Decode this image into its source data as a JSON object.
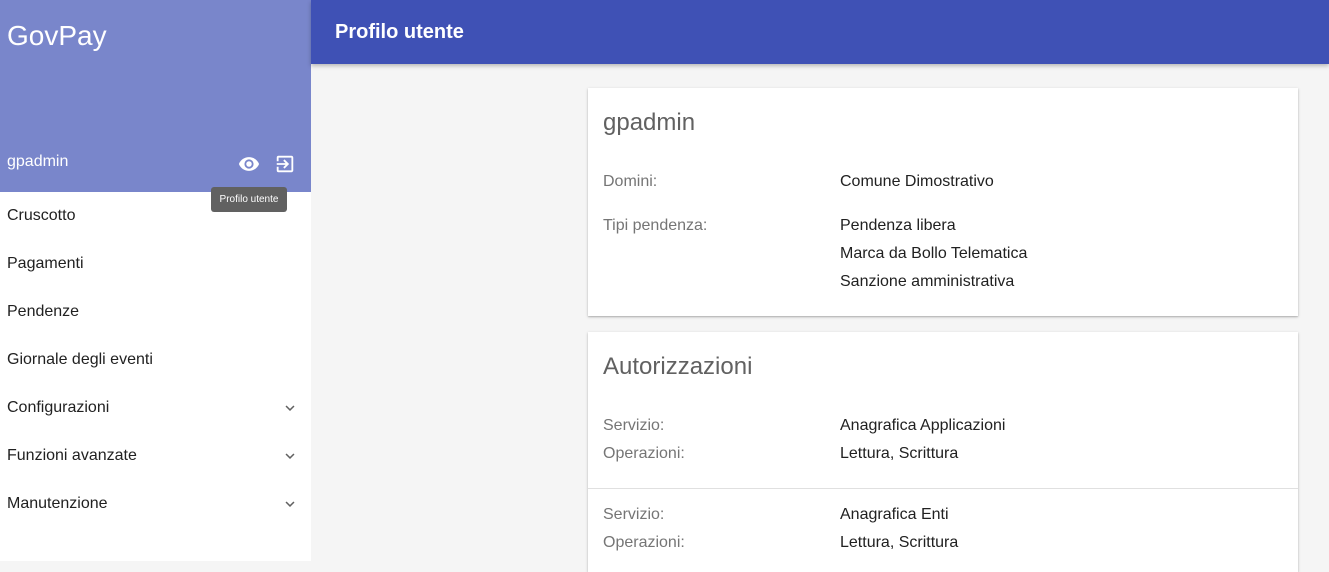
{
  "app": {
    "title": "GovPay"
  },
  "user": {
    "name": "gpadmin"
  },
  "tooltip": {
    "text": "Profilo utente"
  },
  "menu": {
    "items": [
      {
        "label": "Cruscotto"
      },
      {
        "label": "Pagamenti"
      },
      {
        "label": "Pendenze"
      },
      {
        "label": "Giornale degli eventi"
      },
      {
        "label": "Configurazioni"
      },
      {
        "label": "Funzioni avanzate"
      },
      {
        "label": "Manutenzione"
      }
    ]
  },
  "topbar": {
    "title": "Profilo utente"
  },
  "profile": {
    "title": "gpadmin",
    "domini_label": "Domini:",
    "domini": [
      "Comune Dimostrativo"
    ],
    "tipi_label": "Tipi pendenza:",
    "tipi": [
      "Pendenza libera",
      "Marca da Bollo Telematica",
      "Sanzione amministrativa"
    ]
  },
  "auth": {
    "title": "Autorizzazioni",
    "entries": [
      {
        "servizio_label": "Servizio:",
        "servizio": "Anagrafica Applicazioni",
        "operazioni_label": "Operazioni:",
        "operazioni": "Lettura, Scrittura"
      },
      {
        "servizio_label": "Servizio:",
        "servizio": "Anagrafica Enti",
        "operazioni_label": "Operazioni:",
        "operazioni": "Lettura, Scrittura"
      }
    ]
  },
  "colors": {
    "sidebar_header": "#7986cb",
    "topbar": "#3f51b5",
    "background": "#f5f5f5"
  }
}
